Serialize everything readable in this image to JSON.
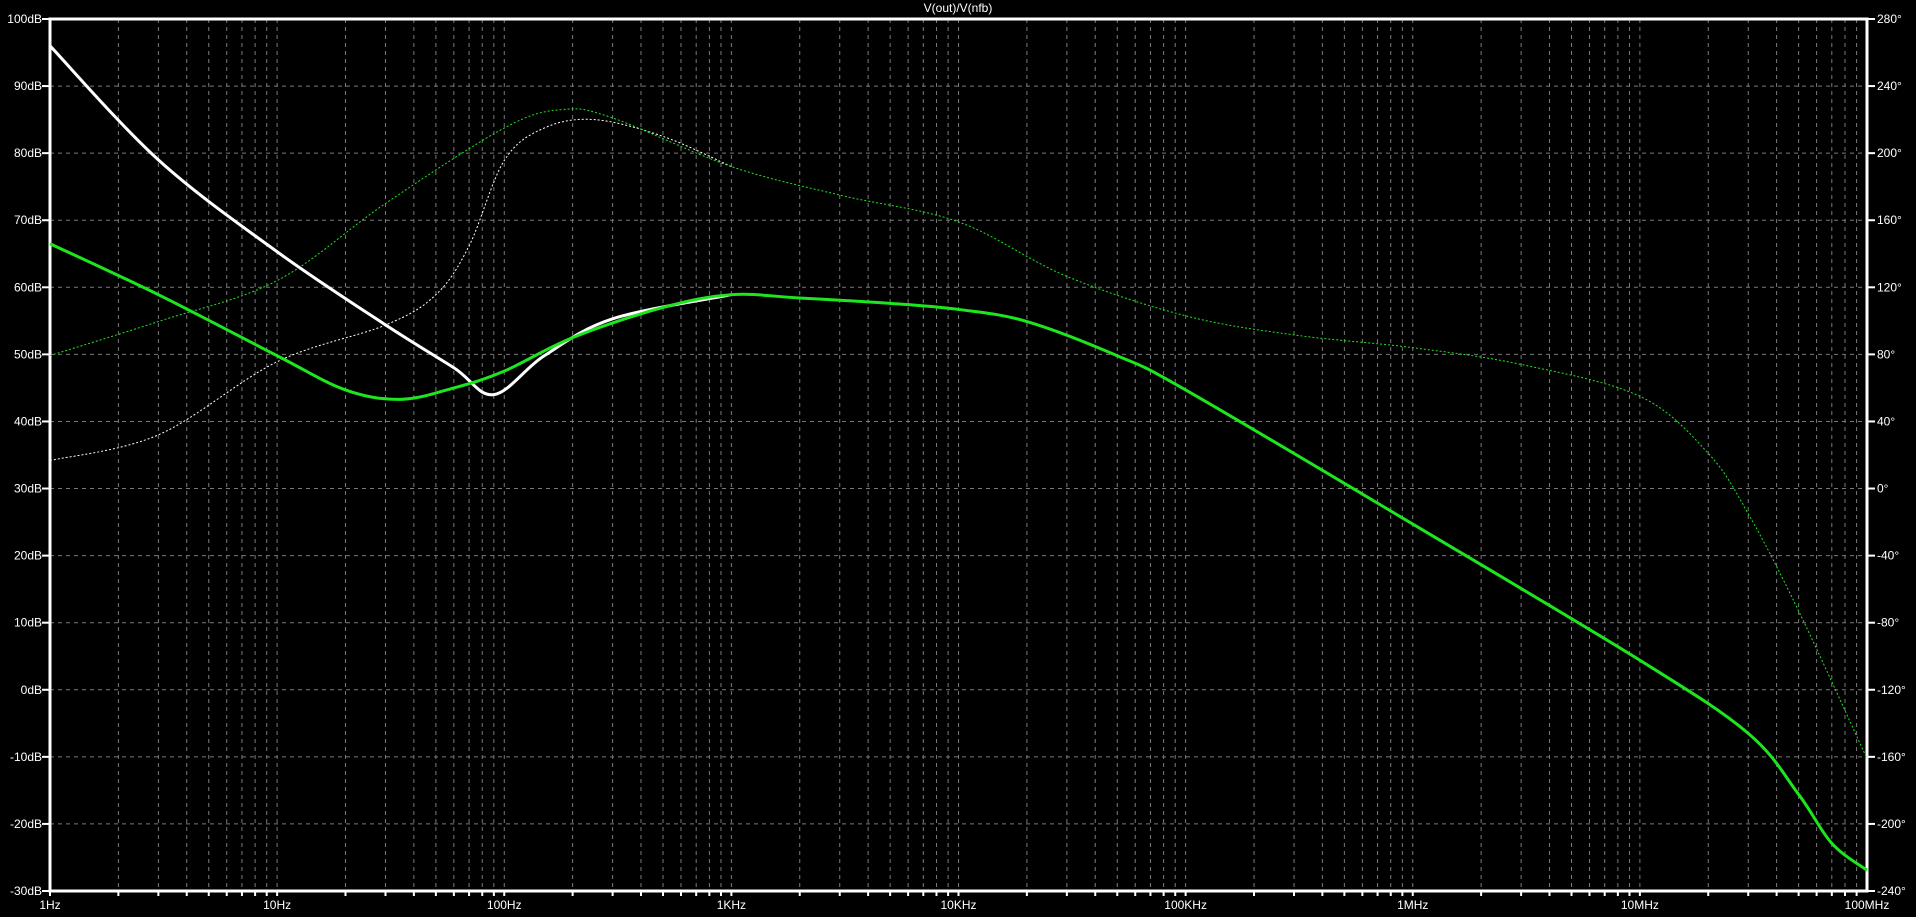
{
  "chart_data": {
    "type": "line",
    "title": "V(out)/V(nfb)",
    "x_scale": "log",
    "xlim": [
      1,
      100000000
    ],
    "x_ticks": [
      {
        "value": 1,
        "label": "1Hz"
      },
      {
        "value": 10,
        "label": "10Hz"
      },
      {
        "value": 100,
        "label": "100Hz"
      },
      {
        "value": 1000,
        "label": "1KHz"
      },
      {
        "value": 10000,
        "label": "10KHz"
      },
      {
        "value": 100000,
        "label": "100KHz"
      },
      {
        "value": 1000000,
        "label": "1MHz"
      },
      {
        "value": 10000000,
        "label": "10MHz"
      },
      {
        "value": 100000000,
        "label": "100MHz"
      }
    ],
    "ylim_left": [
      -30,
      100
    ],
    "y_ticks_left": [
      {
        "value": 100,
        "label": "100dB"
      },
      {
        "value": 90,
        "label": "90dB"
      },
      {
        "value": 80,
        "label": "80dB"
      },
      {
        "value": 70,
        "label": "70dB"
      },
      {
        "value": 60,
        "label": "60dB"
      },
      {
        "value": 50,
        "label": "50dB"
      },
      {
        "value": 40,
        "label": "40dB"
      },
      {
        "value": 30,
        "label": "30dB"
      },
      {
        "value": 20,
        "label": "20dB"
      },
      {
        "value": 10,
        "label": "10dB"
      },
      {
        "value": 0,
        "label": "0dB"
      },
      {
        "value": -10,
        "label": "-10dB"
      },
      {
        "value": -20,
        "label": "-20dB"
      },
      {
        "value": -30,
        "label": "-30dB"
      }
    ],
    "ylim_right": [
      -240,
      280
    ],
    "y_ticks_right": [
      {
        "value": 280,
        "label": "280°"
      },
      {
        "value": 240,
        "label": "240°"
      },
      {
        "value": 200,
        "label": "200°"
      },
      {
        "value": 160,
        "label": "160°"
      },
      {
        "value": 120,
        "label": "120°"
      },
      {
        "value": 80,
        "label": "80°"
      },
      {
        "value": 40,
        "label": "40°"
      },
      {
        "value": 0,
        "label": "0°"
      },
      {
        "value": -40,
        "label": "-40°"
      },
      {
        "value": -80,
        "label": "-80°"
      },
      {
        "value": -120,
        "label": "-120°"
      },
      {
        "value": -160,
        "label": "-160°"
      },
      {
        "value": -200,
        "label": "-200°"
      },
      {
        "value": -240,
        "label": "-240°"
      }
    ],
    "grid": true,
    "series": [
      {
        "name": "magnitude-white",
        "axis": "left",
        "style": "solid",
        "color": "#ffffff",
        "x": [
          1,
          3,
          10,
          30,
          60,
          90,
          150,
          300,
          1000
        ],
        "y": [
          96,
          79,
          65.3,
          54.4,
          48,
          44,
          49.8,
          55.3,
          58.9
        ]
      },
      {
        "name": "magnitude-green",
        "axis": "left",
        "style": "solid",
        "color": "#1ee61e",
        "x": [
          1,
          3,
          10,
          20,
          35,
          60,
          100,
          200,
          500,
          1000,
          2000,
          5000,
          10000,
          20000,
          50000,
          100000,
          1000000,
          10000000,
          30000000,
          50000000,
          70000000,
          100000000
        ],
        "y": [
          66.5,
          58.9,
          49.8,
          44.7,
          43.3,
          45,
          47.5,
          52.5,
          57,
          58.9,
          58.4,
          57.6,
          56.7,
          54.9,
          49.8,
          44.7,
          24.7,
          4.4,
          -6.5,
          -15.6,
          -22.9,
          -26.9
        ]
      },
      {
        "name": "phase-green",
        "axis": "right",
        "style": "dotted",
        "color": "#1ee61e",
        "x": [
          1,
          3,
          10,
          30,
          100,
          180,
          300,
          1000,
          3000,
          10000,
          30000,
          100000,
          300000,
          1000000,
          3000000,
          10000000,
          20000000,
          30000000,
          50000000,
          100000000
        ],
        "y": [
          79.3,
          99.6,
          124,
          170,
          215,
          226,
          221,
          192,
          175,
          159,
          126.5,
          103,
          91.6,
          84,
          74,
          55,
          21,
          -15,
          -73,
          -161
        ]
      },
      {
        "name": "phase-white",
        "axis": "right",
        "style": "dotted",
        "color": "#ffffff",
        "x": [
          1,
          3,
          10,
          30,
          50,
          70,
          100,
          150,
          250,
          500,
          1000
        ],
        "y": [
          16.7,
          32,
          75.6,
          97.5,
          115.6,
          144.7,
          195.6,
          215,
          220,
          210,
          192
        ]
      }
    ]
  }
}
